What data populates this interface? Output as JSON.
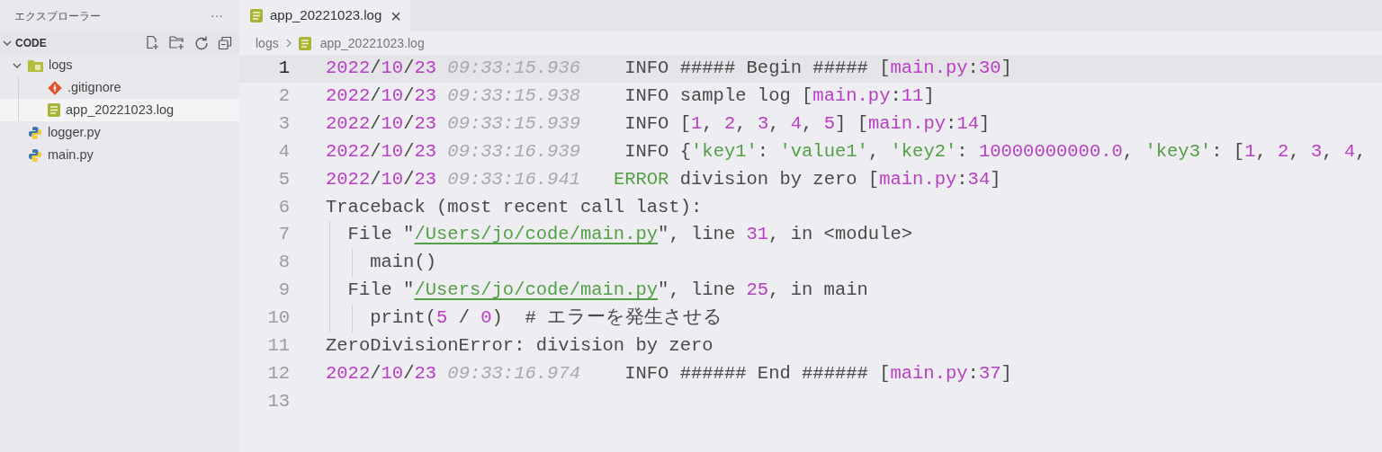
{
  "sidebar": {
    "title": "エクスプローラー",
    "more": "···",
    "section": {
      "title": "CODE",
      "expanded": true
    },
    "tree": [
      {
        "label": "logs",
        "kind": "folder",
        "expanded": true,
        "selected": false,
        "children": [
          {
            "label": ".gitignore",
            "kind": "git",
            "selected": false
          },
          {
            "label": "app_20221023.log",
            "kind": "log",
            "selected": true
          }
        ]
      },
      {
        "label": "logger.py",
        "kind": "python",
        "selected": false
      },
      {
        "label": "main.py",
        "kind": "python",
        "selected": false
      }
    ]
  },
  "tabs": [
    {
      "label": "app_20221023.log",
      "kind": "log",
      "selected": true,
      "close": "×"
    }
  ],
  "breadcrumb": [
    {
      "label": "logs"
    },
    {
      "label": "app_20221023.log",
      "kind": "log"
    }
  ],
  "lines": [
    {
      "number": "1",
      "current": true,
      "tokens": [
        {
          "kind": "num",
          "text": "2022"
        },
        {
          "kind": "text",
          "text": "/"
        },
        {
          "kind": "num",
          "text": "10"
        },
        {
          "kind": "text",
          "text": "/"
        },
        {
          "kind": "num",
          "text": "23"
        },
        {
          "kind": "time",
          "text": " 09:33:15.936"
        },
        {
          "kind": "text",
          "text": "    INFO ##### Begin ##### ["
        },
        {
          "kind": "num",
          "text": "main.py"
        },
        {
          "kind": "text",
          "text": ":"
        },
        {
          "kind": "num",
          "text": "30"
        },
        {
          "kind": "text",
          "text": "]"
        }
      ]
    },
    {
      "number": "2",
      "current": false,
      "tokens": [
        {
          "kind": "num",
          "text": "2022"
        },
        {
          "kind": "text",
          "text": "/"
        },
        {
          "kind": "num",
          "text": "10"
        },
        {
          "kind": "text",
          "text": "/"
        },
        {
          "kind": "num",
          "text": "23"
        },
        {
          "kind": "time",
          "text": " 09:33:15.938"
        },
        {
          "kind": "text",
          "text": "    INFO sample log ["
        },
        {
          "kind": "num",
          "text": "main.py"
        },
        {
          "kind": "text",
          "text": ":"
        },
        {
          "kind": "num",
          "text": "11"
        },
        {
          "kind": "text",
          "text": "]"
        }
      ]
    },
    {
      "number": "3",
      "current": false,
      "tokens": [
        {
          "kind": "num",
          "text": "2022"
        },
        {
          "kind": "text",
          "text": "/"
        },
        {
          "kind": "num",
          "text": "10"
        },
        {
          "kind": "text",
          "text": "/"
        },
        {
          "kind": "num",
          "text": "23"
        },
        {
          "kind": "time",
          "text": " 09:33:15.939"
        },
        {
          "kind": "text",
          "text": "    INFO ["
        },
        {
          "kind": "num",
          "text": "1"
        },
        {
          "kind": "text",
          "text": ", "
        },
        {
          "kind": "num",
          "text": "2"
        },
        {
          "kind": "text",
          "text": ", "
        },
        {
          "kind": "num",
          "text": "3"
        },
        {
          "kind": "text",
          "text": ", "
        },
        {
          "kind": "num",
          "text": "4"
        },
        {
          "kind": "text",
          "text": ", "
        },
        {
          "kind": "num",
          "text": "5"
        },
        {
          "kind": "text",
          "text": "] ["
        },
        {
          "kind": "num",
          "text": "main.py"
        },
        {
          "kind": "text",
          "text": ":"
        },
        {
          "kind": "num",
          "text": "14"
        },
        {
          "kind": "text",
          "text": "]"
        }
      ]
    },
    {
      "number": "4",
      "current": false,
      "tokens": [
        {
          "kind": "num",
          "text": "2022"
        },
        {
          "kind": "text",
          "text": "/"
        },
        {
          "kind": "num",
          "text": "10"
        },
        {
          "kind": "text",
          "text": "/"
        },
        {
          "kind": "num",
          "text": "23"
        },
        {
          "kind": "time",
          "text": " 09:33:16.939"
        },
        {
          "kind": "text",
          "text": "    INFO {"
        },
        {
          "kind": "str",
          "text": "'key1'"
        },
        {
          "kind": "text",
          "text": ": "
        },
        {
          "kind": "str",
          "text": "'value1'"
        },
        {
          "kind": "text",
          "text": ", "
        },
        {
          "kind": "str",
          "text": "'key2'"
        },
        {
          "kind": "text",
          "text": ": "
        },
        {
          "kind": "num",
          "text": "10000000000.0"
        },
        {
          "kind": "text",
          "text": ", "
        },
        {
          "kind": "str",
          "text": "'key3'"
        },
        {
          "kind": "text",
          "text": ": ["
        },
        {
          "kind": "num",
          "text": "1"
        },
        {
          "kind": "text",
          "text": ", "
        },
        {
          "kind": "num",
          "text": "2"
        },
        {
          "kind": "text",
          "text": ", "
        },
        {
          "kind": "num",
          "text": "3"
        },
        {
          "kind": "text",
          "text": ", "
        },
        {
          "kind": "num",
          "text": "4"
        },
        {
          "kind": "text",
          "text": ","
        }
      ]
    },
    {
      "number": "5",
      "current": false,
      "tokens": [
        {
          "kind": "num",
          "text": "2022"
        },
        {
          "kind": "text",
          "text": "/"
        },
        {
          "kind": "num",
          "text": "10"
        },
        {
          "kind": "text",
          "text": "/"
        },
        {
          "kind": "num",
          "text": "23"
        },
        {
          "kind": "time",
          "text": " 09:33:16.941"
        },
        {
          "kind": "str",
          "text": "   ERROR"
        },
        {
          "kind": "text",
          "text": " division by zero ["
        },
        {
          "kind": "num",
          "text": "main.py"
        },
        {
          "kind": "text",
          "text": ":"
        },
        {
          "kind": "num",
          "text": "34"
        },
        {
          "kind": "text",
          "text": "]"
        }
      ]
    },
    {
      "number": "6",
      "current": false,
      "tokens": [
        {
          "kind": "text",
          "text": "Traceback (most recent call last):"
        }
      ]
    },
    {
      "number": "7",
      "current": false,
      "tokens": [
        {
          "kind": "text",
          "text": "  File \""
        },
        {
          "kind": "link",
          "text": "/Users/jo/code/main.py"
        },
        {
          "kind": "text",
          "text": "\", line "
        },
        {
          "kind": "num",
          "text": "31"
        },
        {
          "kind": "text",
          "text": ", in <module>"
        }
      ]
    },
    {
      "number": "8",
      "current": false,
      "tokens": [
        {
          "kind": "text",
          "text": "    main()"
        }
      ]
    },
    {
      "number": "9",
      "current": false,
      "tokens": [
        {
          "kind": "text",
          "text": "  File \""
        },
        {
          "kind": "link",
          "text": "/Users/jo/code/main.py"
        },
        {
          "kind": "text",
          "text": "\", line "
        },
        {
          "kind": "num",
          "text": "25"
        },
        {
          "kind": "text",
          "text": ", in main"
        }
      ]
    },
    {
      "number": "10",
      "current": false,
      "tokens": [
        {
          "kind": "text",
          "text": "    print("
        },
        {
          "kind": "num",
          "text": "5"
        },
        {
          "kind": "text",
          "text": " / "
        },
        {
          "kind": "num",
          "text": "0"
        },
        {
          "kind": "text",
          "text": ")  # エラーを発生させる"
        }
      ]
    },
    {
      "number": "11",
      "current": false,
      "tokens": [
        {
          "kind": "text",
          "text": "ZeroDivisionError: division by zero"
        }
      ]
    },
    {
      "number": "12",
      "current": false,
      "tokens": [
        {
          "kind": "num",
          "text": "2022"
        },
        {
          "kind": "text",
          "text": "/"
        },
        {
          "kind": "num",
          "text": "10"
        },
        {
          "kind": "text",
          "text": "/"
        },
        {
          "kind": "num",
          "text": "23"
        },
        {
          "kind": "time",
          "text": " 09:33:16.974"
        },
        {
          "kind": "text",
          "text": "    INFO ###### End ###### ["
        },
        {
          "kind": "num",
          "text": "main.py"
        },
        {
          "kind": "text",
          "text": ":"
        },
        {
          "kind": "num",
          "text": "37"
        },
        {
          "kind": "text",
          "text": "]"
        }
      ]
    },
    {
      "number": "13",
      "current": false
    }
  ]
}
